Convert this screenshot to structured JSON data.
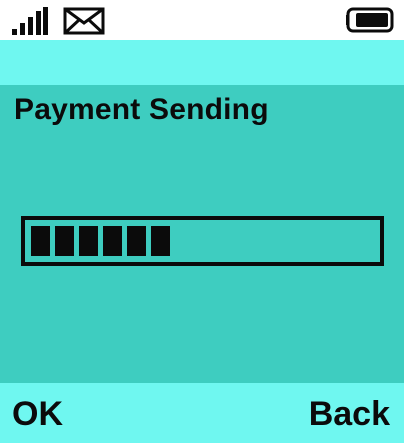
{
  "status_bar": {
    "signal_icon": "signal-strength-icon",
    "mail_icon": "envelope-icon",
    "battery_icon": "battery-icon"
  },
  "screen": {
    "title": "Payment Sending"
  },
  "progress": {
    "filled_segments": 6,
    "fraction": 0.48
  },
  "softkeys": {
    "left_label": "OK",
    "right_label": "Back"
  },
  "colors": {
    "header_band": "#6ff7f0",
    "content_bg": "#3ecdc0",
    "foreground": "#0b0b0b"
  }
}
